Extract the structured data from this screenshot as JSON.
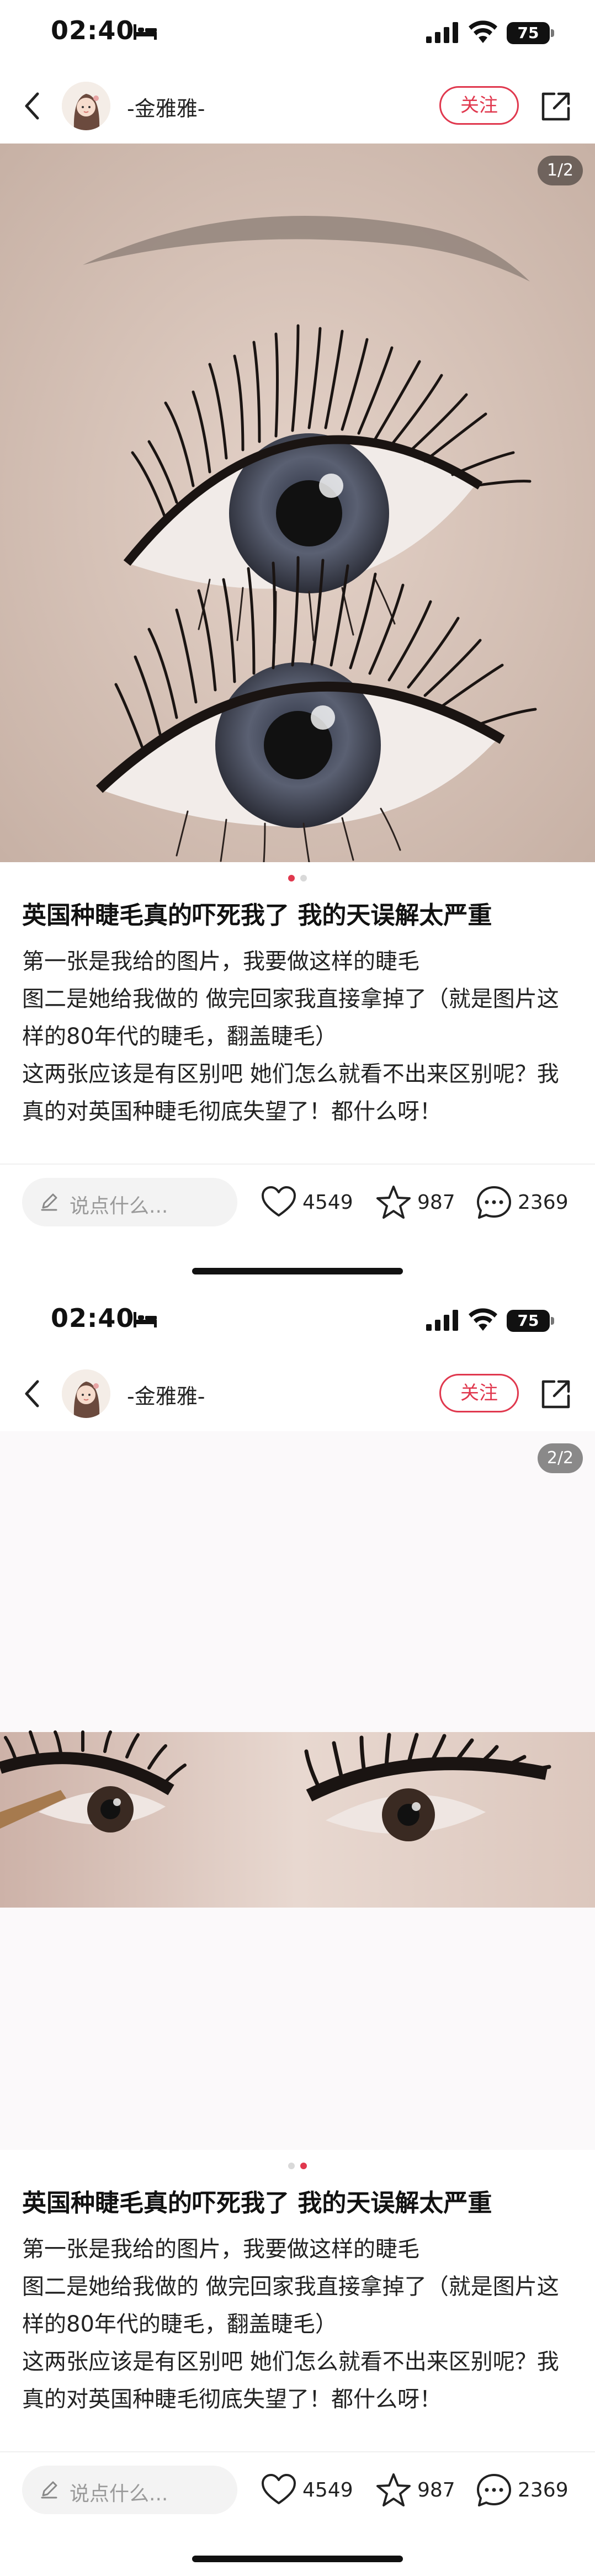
{
  "status_bar": {
    "time": "02:40",
    "battery": "75"
  },
  "nav": {
    "author": "-金雅雅-",
    "follow_label": "关注"
  },
  "post": {
    "title": "英国种睫毛真的吓死我了 我的天误解太严重",
    "body": [
      "第一张是我给的图片，我要做这样的睫毛",
      "图二是她给我做的 做完回家我直接拿掉了（就是图片这样的80年代的睫毛，翻盖睫毛）",
      "这两张应该是有区别吧 她们怎么就看不出来区别呢？我真的对英国种睫毛彻底失望了！都什么呀！"
    ]
  },
  "actions": {
    "comment_placeholder": "说点什么...",
    "likes": "4549",
    "favorites": "987",
    "comments": "2369"
  },
  "screens": [
    {
      "counter": "1/2",
      "active_dot": 0
    },
    {
      "counter": "2/2",
      "active_dot": 1
    }
  ],
  "colors": {
    "accent": "#e0384e",
    "text": "#222222"
  },
  "icons": [
    "bed-icon",
    "signal-icon",
    "wifi-icon",
    "back-icon",
    "share-icon",
    "pen-icon",
    "heart-icon",
    "star-icon",
    "comment-icon"
  ]
}
